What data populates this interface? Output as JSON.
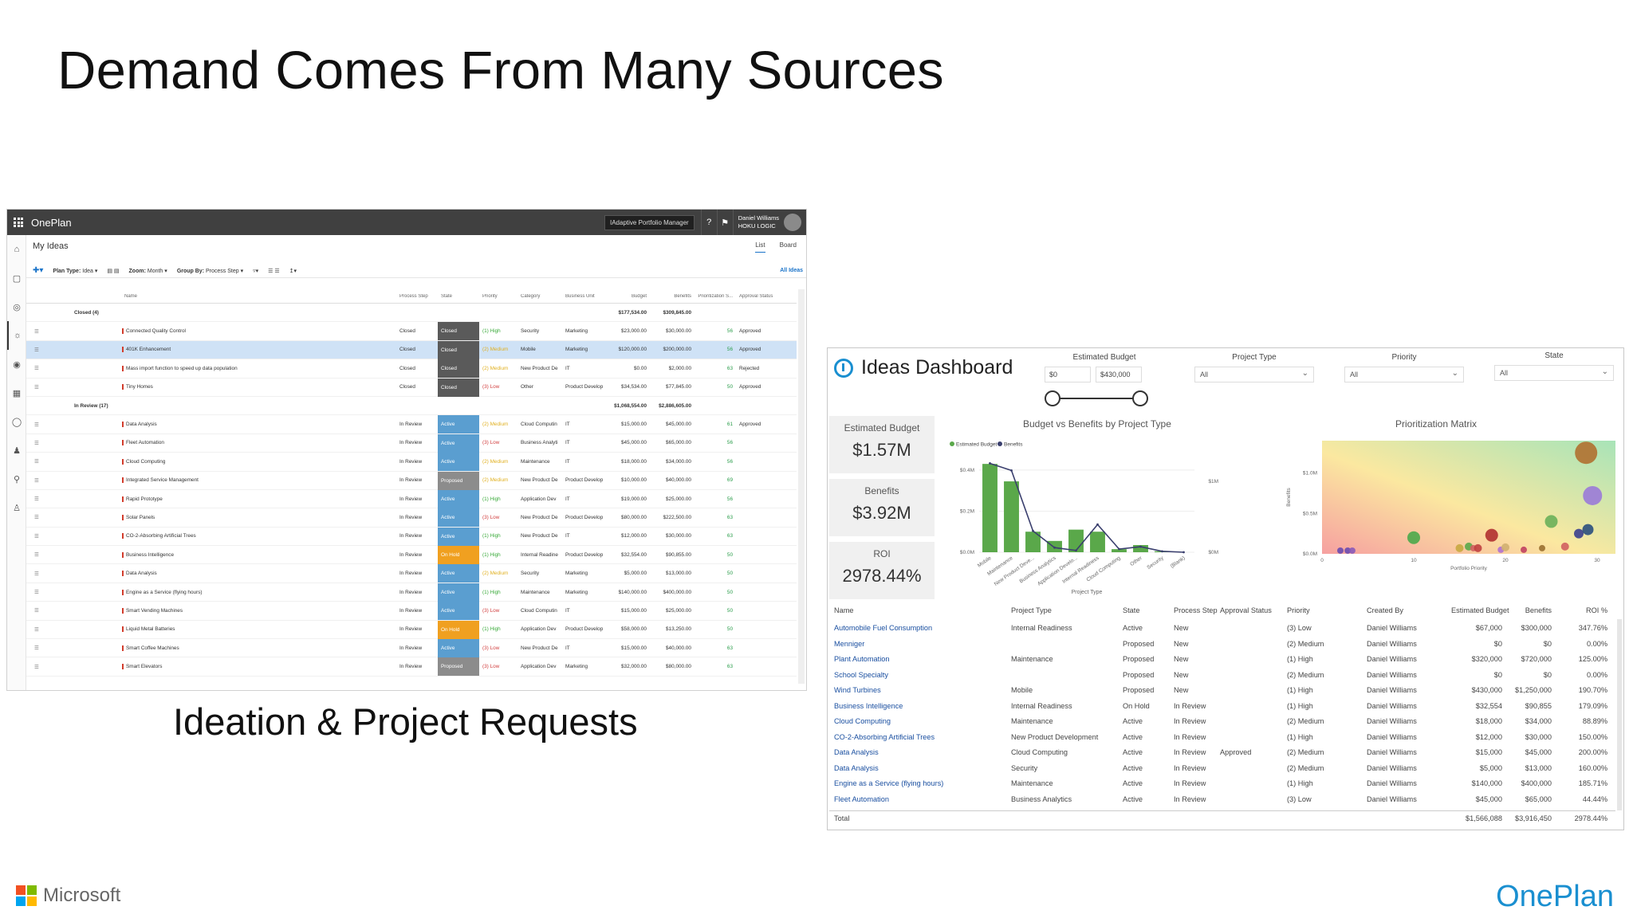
{
  "slide": {
    "title": "Demand Comes From Many Sources",
    "caption": "Ideation & Project Requests"
  },
  "app": {
    "brand": "OnePlan",
    "role": "IAdaptive Portfolio Manager",
    "user_name": "Daniel Williams",
    "user_org": "HOKU LOGIC",
    "page_title": "My Ideas",
    "views": {
      "list": "List",
      "board": "Board"
    },
    "toolbar": {
      "plan_type_label": "Plan Type:",
      "plan_type": "Idea",
      "zoom_label": "Zoom:",
      "zoom": "Month",
      "group_label": "Group By:",
      "group": "Process Step",
      "all_ideas": "All Ideas"
    },
    "columns": {
      "name": "Name",
      "process_step": "Process Step",
      "state": "State",
      "priority": "Priority",
      "category": "Category",
      "business_unit": "Business Unit",
      "budget": "Budget",
      "benefits": "Benefits",
      "prioritization": "Prioritization S...",
      "approval": "Approval Status"
    },
    "groups": [
      {
        "label": "Closed (4)",
        "budget": "$177,534.00",
        "benefits": "$309,845.00",
        "rows": [
          {
            "name": "Connected Quality Control",
            "step": "Closed",
            "state": "Closed",
            "priority": "(1) High",
            "pcls": "p-high",
            "category": "Security",
            "bu": "Marketing",
            "budget": "$23,000.00",
            "benefits": "$30,000.00",
            "score": "56",
            "approval": "Approved",
            "selected": false
          },
          {
            "name": "401K Enhancement",
            "step": "Closed",
            "state": "Closed",
            "priority": "(2) Medium",
            "pcls": "p-med",
            "category": "Mobile",
            "bu": "Marketing",
            "budget": "$120,000.00",
            "benefits": "$200,000.00",
            "score": "56",
            "approval": "Approved",
            "selected": true
          },
          {
            "name": "Mass import function to speed up data population",
            "step": "Closed",
            "state": "Closed",
            "priority": "(2) Medium",
            "pcls": "p-med",
            "category": "New Product De",
            "bu": "IT",
            "budget": "$0.00",
            "benefits": "$2,000.00",
            "score": "63",
            "approval": "Rejected",
            "selected": false
          },
          {
            "name": "Tiny Homes",
            "step": "Closed",
            "state": "Closed",
            "priority": "(3) Low",
            "pcls": "p-low",
            "category": "Other",
            "bu": "Product Develop",
            "budget": "$34,534.00",
            "benefits": "$77,845.00",
            "score": "50",
            "approval": "Approved",
            "selected": false
          }
        ]
      },
      {
        "label": "In Review (17)",
        "budget": "$1,068,554.00",
        "benefits": "$2,886,605.00",
        "rows": [
          {
            "name": "Data Analysis",
            "step": "In Review",
            "state": "Active",
            "priority": "(2) Medium",
            "pcls": "p-med",
            "category": "Cloud Computin",
            "bu": "IT",
            "budget": "$15,000.00",
            "benefits": "$45,000.00",
            "score": "61",
            "approval": "Approved",
            "selected": false
          },
          {
            "name": "Fleet Automation",
            "step": "In Review",
            "state": "Active",
            "priority": "(3) Low",
            "pcls": "p-low",
            "category": "Business Analyti",
            "bu": "IT",
            "budget": "$45,000.00",
            "benefits": "$65,000.00",
            "score": "56",
            "approval": "",
            "selected": false
          },
          {
            "name": "Cloud Computing",
            "step": "In Review",
            "state": "Active",
            "priority": "(2) Medium",
            "pcls": "p-med",
            "category": "Maintenance",
            "bu": "IT",
            "budget": "$18,000.00",
            "benefits": "$34,000.00",
            "score": "56",
            "approval": "",
            "selected": false
          },
          {
            "name": "Integrated Service Management",
            "step": "In Review",
            "state": "Proposed",
            "priority": "(2) Medium",
            "pcls": "p-med",
            "category": "New Product De",
            "bu": "Product Develop",
            "budget": "$10,000.00",
            "benefits": "$40,000.00",
            "score": "69",
            "approval": "",
            "selected": false
          },
          {
            "name": "Rapid Prototype",
            "step": "In Review",
            "state": "Active",
            "priority": "(1) High",
            "pcls": "p-high",
            "category": "Application Dev",
            "bu": "IT",
            "budget": "$19,000.00",
            "benefits": "$25,000.00",
            "score": "56",
            "approval": "",
            "selected": false
          },
          {
            "name": "Solar Panels",
            "step": "In Review",
            "state": "Active",
            "priority": "(3) Low",
            "pcls": "p-low",
            "category": "New Product De",
            "bu": "Product Develop",
            "budget": "$80,000.00",
            "benefits": "$222,500.00",
            "score": "63",
            "approval": "",
            "selected": false
          },
          {
            "name": "CO-2-Absorbing Artificial Trees",
            "step": "In Review",
            "state": "Active",
            "priority": "(1) High",
            "pcls": "p-high",
            "category": "New Product De",
            "bu": "IT",
            "budget": "$12,000.00",
            "benefits": "$30,000.00",
            "score": "63",
            "approval": "",
            "selected": false
          },
          {
            "name": "Business Intelligence",
            "step": "In Review",
            "state": "On Hold",
            "priority": "(1) High",
            "pcls": "p-high",
            "category": "Internal Readine",
            "bu": "Product Develop",
            "budget": "$32,554.00",
            "benefits": "$90,855.00",
            "score": "50",
            "approval": "",
            "selected": false
          },
          {
            "name": "Data Analysis",
            "step": "In Review",
            "state": "Active",
            "priority": "(2) Medium",
            "pcls": "p-med",
            "category": "Security",
            "bu": "Marketing",
            "budget": "$5,000.00",
            "benefits": "$13,000.00",
            "score": "50",
            "approval": "",
            "selected": false
          },
          {
            "name": "Engine as a Service (flying hours)",
            "step": "In Review",
            "state": "Active",
            "priority": "(1) High",
            "pcls": "p-high",
            "category": "Maintenance",
            "bu": "Marketing",
            "budget": "$140,000.00",
            "benefits": "$400,000.00",
            "score": "50",
            "approval": "",
            "selected": false
          },
          {
            "name": "Smart Vending Machines",
            "step": "In Review",
            "state": "Active",
            "priority": "(3) Low",
            "pcls": "p-low",
            "category": "Cloud Computin",
            "bu": "IT",
            "budget": "$15,000.00",
            "benefits": "$25,000.00",
            "score": "50",
            "approval": "",
            "selected": false
          },
          {
            "name": "Liquid Metal Batteries",
            "step": "In Review",
            "state": "On Hold",
            "priority": "(1) High",
            "pcls": "p-high",
            "category": "Application Dev",
            "bu": "Product Develop",
            "budget": "$58,000.00",
            "benefits": "$13,250.00",
            "score": "50",
            "approval": "",
            "selected": false
          },
          {
            "name": "Smart Coffee Machines",
            "step": "In Review",
            "state": "Active",
            "priority": "(3) Low",
            "pcls": "p-low",
            "category": "New Product De",
            "bu": "IT",
            "budget": "$15,000.00",
            "benefits": "$40,000.00",
            "score": "63",
            "approval": "",
            "selected": false
          },
          {
            "name": "Smart Elevators",
            "step": "In Review",
            "state": "Proposed",
            "priority": "(3) Low",
            "pcls": "p-low",
            "category": "Application Dev",
            "bu": "Marketing",
            "budget": "$32,000.00",
            "benefits": "$80,000.00",
            "score": "63",
            "approval": "",
            "selected": false
          }
        ]
      }
    ]
  },
  "dashboard": {
    "title": "Ideas Dashboard",
    "filters": {
      "budget_label": "Estimated Budget",
      "budget_min": "$0",
      "budget_max": "$430,000",
      "project_type_label": "Project Type",
      "project_type": "All",
      "priority_label": "Priority",
      "priority": "All",
      "state_label": "State",
      "state": "All"
    },
    "kpis": [
      {
        "label": "Estimated Budget",
        "value": "$1.57M"
      },
      {
        "label": "Benefits",
        "value": "$3.92M"
      },
      {
        "label": "ROI",
        "value": "2978.44%"
      }
    ],
    "table": {
      "headers": {
        "name": "Name",
        "pt": "Project Type",
        "st": "State",
        "ps": "Process Step",
        "as": "Approval Status",
        "pr": "Priority",
        "cb": "Created By",
        "eb": "Estimated Budget",
        "be": "Benefits",
        "roi": "ROI %"
      },
      "rows": [
        {
          "name": "Automobile Fuel Consumption",
          "pt": "Internal Readiness",
          "st": "Active",
          "ps": "New",
          "as": "",
          "pr": "(3) Low",
          "cb": "Daniel Williams",
          "eb": "$67,000",
          "be": "$300,000",
          "roi": "347.76%"
        },
        {
          "name": "Menniger",
          "pt": "",
          "st": "Proposed",
          "ps": "New",
          "as": "",
          "pr": "(2) Medium",
          "cb": "Daniel Williams",
          "eb": "$0",
          "be": "$0",
          "roi": "0.00%"
        },
        {
          "name": "Plant Automation",
          "pt": "Maintenance",
          "st": "Proposed",
          "ps": "New",
          "as": "",
          "pr": "(1) High",
          "cb": "Daniel Williams",
          "eb": "$320,000",
          "be": "$720,000",
          "roi": "125.00%"
        },
        {
          "name": "School Specialty",
          "pt": "",
          "st": "Proposed",
          "ps": "New",
          "as": "",
          "pr": "(2) Medium",
          "cb": "Daniel Williams",
          "eb": "$0",
          "be": "$0",
          "roi": "0.00%"
        },
        {
          "name": "Wind Turbines",
          "pt": "Mobile",
          "st": "Proposed",
          "ps": "New",
          "as": "",
          "pr": "(1) High",
          "cb": "Daniel Williams",
          "eb": "$430,000",
          "be": "$1,250,000",
          "roi": "190.70%"
        },
        {
          "name": "Business Intelligence",
          "pt": "Internal Readiness",
          "st": "On Hold",
          "ps": "In Review",
          "as": "",
          "pr": "(1) High",
          "cb": "Daniel Williams",
          "eb": "$32,554",
          "be": "$90,855",
          "roi": "179.09%"
        },
        {
          "name": "Cloud Computing",
          "pt": "Maintenance",
          "st": "Active",
          "ps": "In Review",
          "as": "",
          "pr": "(2) Medium",
          "cb": "Daniel Williams",
          "eb": "$18,000",
          "be": "$34,000",
          "roi": "88.89%"
        },
        {
          "name": "CO-2-Absorbing Artificial Trees",
          "pt": "New Product Development",
          "st": "Active",
          "ps": "In Review",
          "as": "",
          "pr": "(1) High",
          "cb": "Daniel Williams",
          "eb": "$12,000",
          "be": "$30,000",
          "roi": "150.00%"
        },
        {
          "name": "Data Analysis",
          "pt": "Cloud Computing",
          "st": "Active",
          "ps": "In Review",
          "as": "Approved",
          "pr": "(2) Medium",
          "cb": "Daniel Williams",
          "eb": "$15,000",
          "be": "$45,000",
          "roi": "200.00%"
        },
        {
          "name": "Data Analysis",
          "pt": "Security",
          "st": "Active",
          "ps": "In Review",
          "as": "",
          "pr": "(2) Medium",
          "cb": "Daniel Williams",
          "eb": "$5,000",
          "be": "$13,000",
          "roi": "160.00%"
        },
        {
          "name": "Engine as a Service (flying hours)",
          "pt": "Maintenance",
          "st": "Active",
          "ps": "In Review",
          "as": "",
          "pr": "(1) High",
          "cb": "Daniel Williams",
          "eb": "$140,000",
          "be": "$400,000",
          "roi": "185.71%"
        },
        {
          "name": "Fleet Automation",
          "pt": "Business Analytics",
          "st": "Active",
          "ps": "In Review",
          "as": "",
          "pr": "(3) Low",
          "cb": "Daniel Williams",
          "eb": "$45,000",
          "be": "$65,000",
          "roi": "44.44%"
        }
      ],
      "total": {
        "label": "Total",
        "eb": "$1,566,088",
        "be": "$3,916,450",
        "roi": "2978.44%"
      }
    }
  },
  "chart_data": [
    {
      "type": "bar",
      "title": "Budget vs Benefits by Project Type",
      "xlabel": "Project Type",
      "legend": [
        "Estimated Budget",
        "Benefits"
      ],
      "categories": [
        "Mobile",
        "Maintenance",
        "New Product Deve...",
        "Business Analytics",
        "Application Develo...",
        "Internal Readiness",
        "Cloud Computing",
        "Other",
        "Security",
        "(Blank)"
      ],
      "series": [
        {
          "name": "Estimated Budget",
          "axis": "left",
          "values": [
            430000,
            345000,
            100000,
            55000,
            110000,
            100000,
            15000,
            35000,
            5000,
            0
          ]
        },
        {
          "name": "Benefits",
          "axis": "right",
          "values": [
            1250000,
            1150000,
            300000,
            65000,
            25000,
            390000,
            45000,
            78000,
            13000,
            0
          ]
        }
      ],
      "ylim_left": [
        0,
        450000
      ],
      "yticks_left": [
        "$0.0M",
        "$0.2M",
        "$0.4M"
      ],
      "ylim_right": [
        0,
        1300000
      ],
      "yticks_right": [
        "$0M",
        "$1M"
      ],
      "colors": {
        "bar": "#5aa84a",
        "line": "#3a3f6e"
      }
    },
    {
      "type": "scatter",
      "title": "Prioritization Matrix",
      "xlabel": "Portfolio Priority",
      "ylabel": "Benefits",
      "xlim": [
        0,
        32
      ],
      "ylim": [
        0,
        1400000
      ],
      "xticks": [
        "0",
        "10",
        "20",
        "30"
      ],
      "yticks": [
        "$0.0M",
        "$0.5M",
        "$1.0M"
      ],
      "points": [
        {
          "x": 2,
          "y": 40000,
          "size": 4,
          "color": "#6a4bb0"
        },
        {
          "x": 2.8,
          "y": 40000,
          "size": 4,
          "color": "#6a4bb0"
        },
        {
          "x": 3.3,
          "y": 40000,
          "size": 4,
          "color": "#8a5ab8"
        },
        {
          "x": 10,
          "y": 200000,
          "size": 8,
          "color": "#4aa84a"
        },
        {
          "x": 15,
          "y": 70000,
          "size": 5,
          "color": "#c8a840"
        },
        {
          "x": 16,
          "y": 90000,
          "size": 5,
          "color": "#5aa84a"
        },
        {
          "x": 16.5,
          "y": 70000,
          "size": 4,
          "color": "#d06060"
        },
        {
          "x": 17,
          "y": 70000,
          "size": 5,
          "color": "#c04040"
        },
        {
          "x": 18.5,
          "y": 230000,
          "size": 8,
          "color": "#b03030"
        },
        {
          "x": 19.5,
          "y": 50000,
          "size": 4,
          "color": "#b070d0"
        },
        {
          "x": 20,
          "y": 80000,
          "size": 5,
          "color": "#d0b070"
        },
        {
          "x": 22,
          "y": 50000,
          "size": 4,
          "color": "#c04060"
        },
        {
          "x": 24,
          "y": 70000,
          "size": 4,
          "color": "#9a7030"
        },
        {
          "x": 25,
          "y": 400000,
          "size": 8,
          "color": "#6ab05a"
        },
        {
          "x": 26.5,
          "y": 90000,
          "size": 5,
          "color": "#d06060"
        },
        {
          "x": 28,
          "y": 250000,
          "size": 6,
          "color": "#3a3f8e"
        },
        {
          "x": 29,
          "y": 300000,
          "size": 7,
          "color": "#2a4f7e"
        },
        {
          "x": 29.5,
          "y": 720000,
          "size": 12,
          "color": "#9a7ad8"
        },
        {
          "x": 28.8,
          "y": 1250000,
          "size": 14,
          "color": "#b07030"
        }
      ]
    }
  ],
  "footer": {
    "microsoft": "Microsoft",
    "oneplan": "OnePlan"
  }
}
